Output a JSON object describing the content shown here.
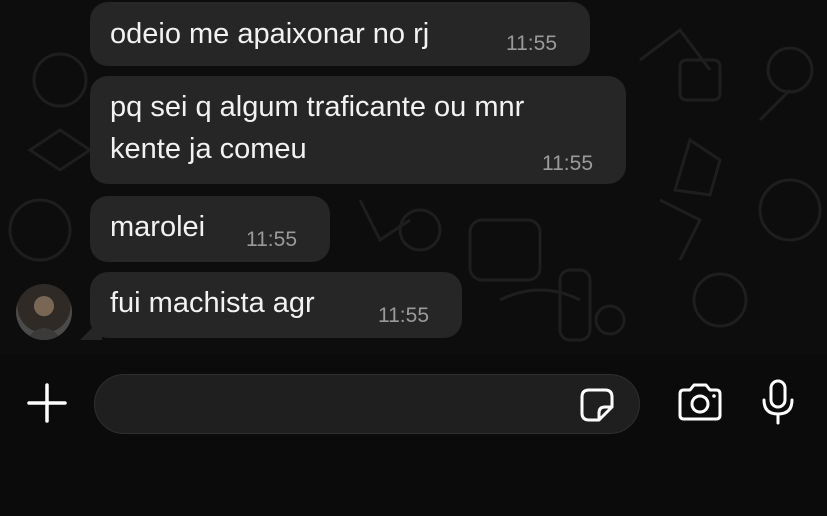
{
  "messages": [
    {
      "text": "odeio me apaixonar no rj",
      "time": "11:55"
    },
    {
      "text": "pq sei q algum traficante ou mnr\nkente ja comeu",
      "time": "11:55"
    },
    {
      "text": "marolei",
      "time": "11:55"
    },
    {
      "text": "fui machista agr",
      "time": "11:55"
    }
  ],
  "composer": {
    "placeholder": "",
    "icons": [
      "plus-icon",
      "sticker-icon",
      "camera-icon",
      "microphone-icon"
    ]
  },
  "colors": {
    "background": "#0d0d0d",
    "bubble": "#262626",
    "text": "#f2f2f2",
    "time": "#9a9a9a",
    "icon": "#ffffff"
  }
}
